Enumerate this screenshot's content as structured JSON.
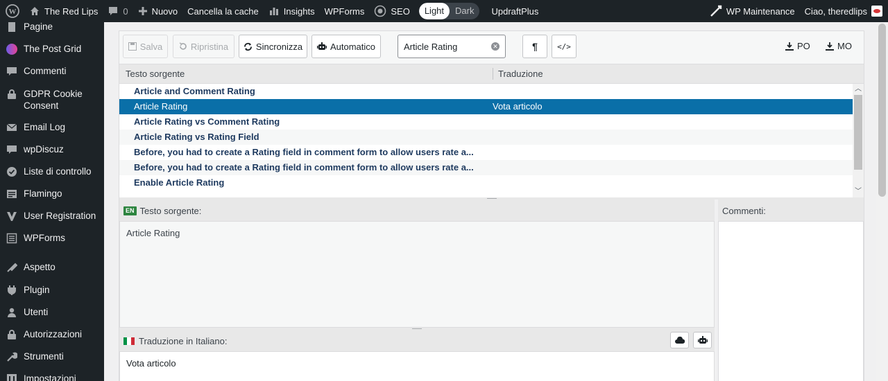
{
  "adminbar": {
    "site_name": "The Red Lips",
    "comments_count": "0",
    "new_label": "Nuovo",
    "clear_cache": "Cancella la cache",
    "insights": "Insights",
    "wpforms": "WPForms",
    "seo": "SEO",
    "theme_light": "Light",
    "theme_dark": "Dark",
    "updraft": "UpdraftPlus",
    "maintenance": "WP Maintenance",
    "greeting": "Ciao, theredlips"
  },
  "sidebar": {
    "items": [
      {
        "label": "Pagine",
        "icon": "pages-icon"
      },
      {
        "label": "The Post Grid",
        "icon": "post-grid-icon"
      },
      {
        "label": "Commenti",
        "icon": "comments-icon"
      },
      {
        "label": "GDPR Cookie Consent",
        "icon": "lock-icon"
      },
      {
        "label": "Email Log",
        "icon": "email-icon"
      },
      {
        "label": "wpDiscuz",
        "icon": "discuz-icon"
      },
      {
        "label": "Liste di controllo",
        "icon": "checklist-icon"
      },
      {
        "label": "Flamingo",
        "icon": "flamingo-icon"
      },
      {
        "label": "User Registration",
        "icon": "user-registration-icon"
      },
      {
        "label": "WPForms",
        "icon": "wpforms-icon"
      },
      {
        "label": "Aspetto",
        "icon": "appearance-icon"
      },
      {
        "label": "Plugin",
        "icon": "plugin-icon"
      },
      {
        "label": "Utenti",
        "icon": "users-icon"
      },
      {
        "label": "Autorizzazioni",
        "icon": "authorizations-icon"
      },
      {
        "label": "Strumenti",
        "icon": "tools-icon"
      },
      {
        "label": "Impostazioni",
        "icon": "settings-icon"
      }
    ]
  },
  "toolbar": {
    "save": "Salva",
    "restore": "Ripristina",
    "sync": "Sincronizza",
    "auto": "Automatico",
    "search_value": "Article Rating",
    "download_po": "PO",
    "download_mo": "MO"
  },
  "list": {
    "col_source": "Testo sorgente",
    "col_translation": "Traduzione",
    "rows": [
      {
        "source": "Article and Comment Rating",
        "translation": ""
      },
      {
        "source": "Article Rating",
        "translation": "Vota articolo"
      },
      {
        "source": "Article Rating vs Comment Rating",
        "translation": ""
      },
      {
        "source": "Article Rating vs Rating Field",
        "translation": ""
      },
      {
        "source": "Before, you had to create a Rating field in comment form to allow users rate a...",
        "translation": ""
      },
      {
        "source": "Before, you had to create a Rating field in comment form to allow users rate a...",
        "translation": ""
      },
      {
        "source": "Enable Article Rating",
        "translation": ""
      }
    ]
  },
  "source_panel": {
    "lang_code": "EN",
    "label": "Testo sorgente:",
    "text": "Article Rating"
  },
  "translation_panel": {
    "label": "Traduzione in Italiano:",
    "text": "Vota articolo"
  },
  "comments_panel": {
    "label": "Commenti:"
  },
  "colors": {
    "accent": "#0a6fa8",
    "adminbar_bg": "#1d2327"
  }
}
